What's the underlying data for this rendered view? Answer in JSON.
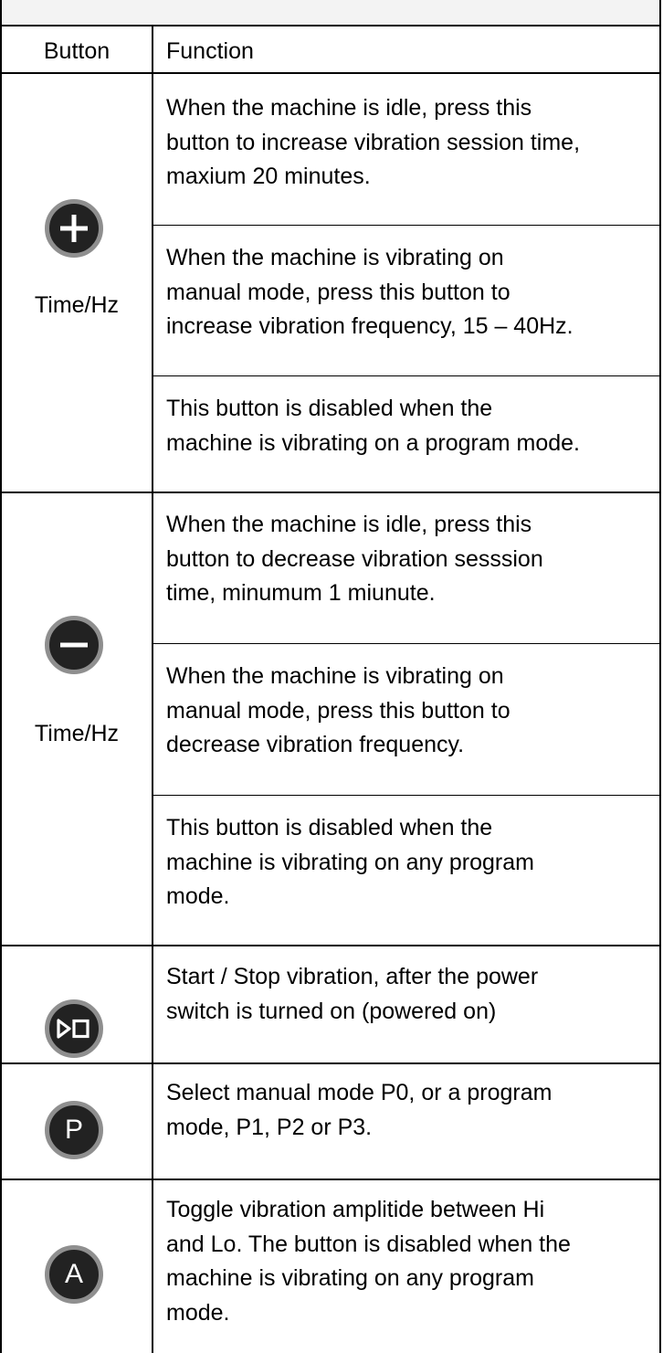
{
  "table": {
    "header": {
      "button": "Button",
      "function": "Function"
    },
    "rows": [
      {
        "icon": "plus-icon",
        "caption": "Time/Hz",
        "cells": [
          [
            "When the machine is idle, press this",
            "button to increase vibration session time,",
            "maxium 20 minutes."
          ],
          [
            "When the machine is vibrating on",
            "manual mode, press this button to",
            "increase vibration frequency, 15 – 40Hz."
          ],
          [
            "This button is disabled when the",
            "machine is vibrating on a program mode."
          ]
        ]
      },
      {
        "icon": "minus-icon",
        "caption": "Time/Hz",
        "cells": [
          [
            "When the machine is idle, press this",
            "button to decrease vibration sesssion",
            "time, minumum 1 miunute."
          ],
          [
            "When the machine is vibrating on",
            "manual mode, press this button to",
            "decrease vibration frequency."
          ],
          [
            "This button is disabled when the",
            "machine is vibrating on any program",
            "mode."
          ]
        ]
      },
      {
        "icon": "start-stop-icon",
        "cells": [
          [
            "Start / Stop vibration, after the power",
            "switch is turned on (powered on)"
          ]
        ]
      },
      {
        "icon": "program-p-icon",
        "letter": "P",
        "cells": [
          [
            "Select manual mode P0, or a program",
            "mode, P1, P2 or P3."
          ]
        ]
      },
      {
        "icon": "amplitude-a-icon",
        "letter": "A",
        "cells": [
          [
            "Toggle vibration amplitide between Hi",
            "and Lo. The button is disabled when the",
            "machine is vibrating on any program",
            "mode."
          ]
        ]
      }
    ]
  },
  "colors": {
    "icon_fill": "#222222",
    "icon_ring": "#8f8f8f",
    "top_bar": "#f3f3f3"
  }
}
